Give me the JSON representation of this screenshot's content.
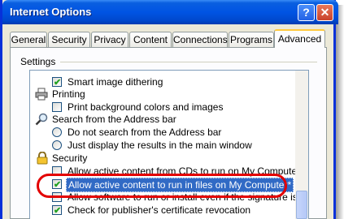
{
  "window": {
    "title": "Internet Options",
    "help_label": "?",
    "close_label": "✕"
  },
  "tabs": [
    "General",
    "Security",
    "Privacy",
    "Content",
    "Connections",
    "Programs",
    "Advanced"
  ],
  "active_tab": "Advanced",
  "settings_label": "Settings",
  "items": [
    {
      "type": "checkbox",
      "label": "Smart image dithering",
      "checked": true
    },
    {
      "type": "category",
      "label": "Printing",
      "icon": "printer-icon"
    },
    {
      "type": "checkbox",
      "label": "Print background colors and images",
      "checked": false
    },
    {
      "type": "category",
      "label": "Search from the Address bar",
      "icon": "magnifier-icon"
    },
    {
      "type": "radio",
      "label": "Do not search from the Address bar",
      "selected": false
    },
    {
      "type": "radio",
      "label": "Just display the results in the main window",
      "selected": false
    },
    {
      "type": "category",
      "label": "Security",
      "icon": "padlock-icon"
    },
    {
      "type": "checkbox",
      "label": "Allow active content from CDs to run on My Computer*",
      "checked": false
    },
    {
      "type": "checkbox",
      "label": "Allow active content to run in files on My Computer*",
      "checked": true,
      "highlighted": true
    },
    {
      "type": "checkbox",
      "label": "Allow software to run or install even if the signature is inva",
      "checked": false
    },
    {
      "type": "checkbox",
      "label": "Check for publisher's certificate revocation",
      "checked": true
    }
  ],
  "colors": {
    "title_bar": "#0054e3",
    "selection": "#316ac5",
    "annotation_oval": "#e30000"
  }
}
